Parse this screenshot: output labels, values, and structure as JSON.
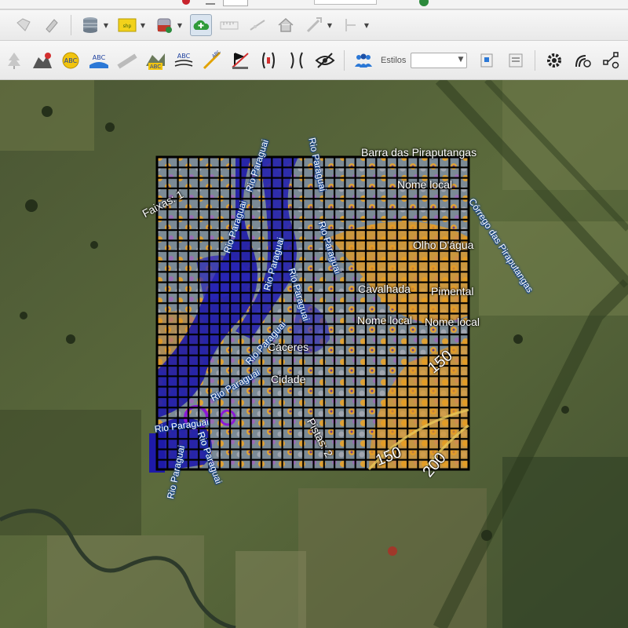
{
  "toolbar_top": {
    "partial_icons": [
      "stop-icon",
      "undo-icon",
      "dropdown-icon"
    ]
  },
  "toolbar1": {
    "icons": [
      "hand-map-icon",
      "tool-icon",
      "database-icon",
      "shapefile-icon",
      "layer-tank-icon",
      "cloud-add-icon",
      "ruler-icon",
      "line-edit-icon",
      "home-icon",
      "node-edit-icon",
      "split-icon"
    ]
  },
  "toolbar2": {
    "icons": [
      "tree-icon",
      "terrain-icon",
      "label-abc-icon",
      "label-abc-road-icon",
      "label-road-icon",
      "label-abc-terrain-icon",
      "label-abc-curve-icon",
      "diagonal-label-icon",
      "no-label-icon",
      "bridge-icon",
      "reverse-bridge-icon",
      "hide-icon",
      "users-icon",
      "copy-style-icon",
      "paste-style-icon",
      "settings-icon",
      "route-icon",
      "network-icon"
    ],
    "styles_label": "Estilos",
    "styles_value": ""
  },
  "map": {
    "labels": {
      "barra": "Barra das Piraputangas",
      "nome_local_1": "Nome local",
      "nome_local_2": "Nome local",
      "nome_local_3": "Nome local",
      "faixas": "Faixas: 1",
      "olho": "Olho D'água",
      "cavalhada": "Cavalhada",
      "pimental": "Pimental",
      "caceres": "Cáceres",
      "cidade": "Cidade",
      "pistas": "Pistas: 2",
      "corrego": "Córrego das Piraputangas",
      "rio1": "Rio Paraguai",
      "rio2": "Rio Paraguai",
      "rio3": "Rio Paraguai",
      "rio4": "Rio Paraguai",
      "rio5": "Rio Paraguai",
      "rio6": "Rio Paraguai",
      "rio7": "Rio Paraguai",
      "rio8": "Rio Paraguai",
      "rio9": "Rio Paraguai",
      "rio10": "Rio Paraguai",
      "rio11": "Rio Paraguai",
      "c150a": "150",
      "c150b": "150",
      "c200": "200"
    }
  }
}
